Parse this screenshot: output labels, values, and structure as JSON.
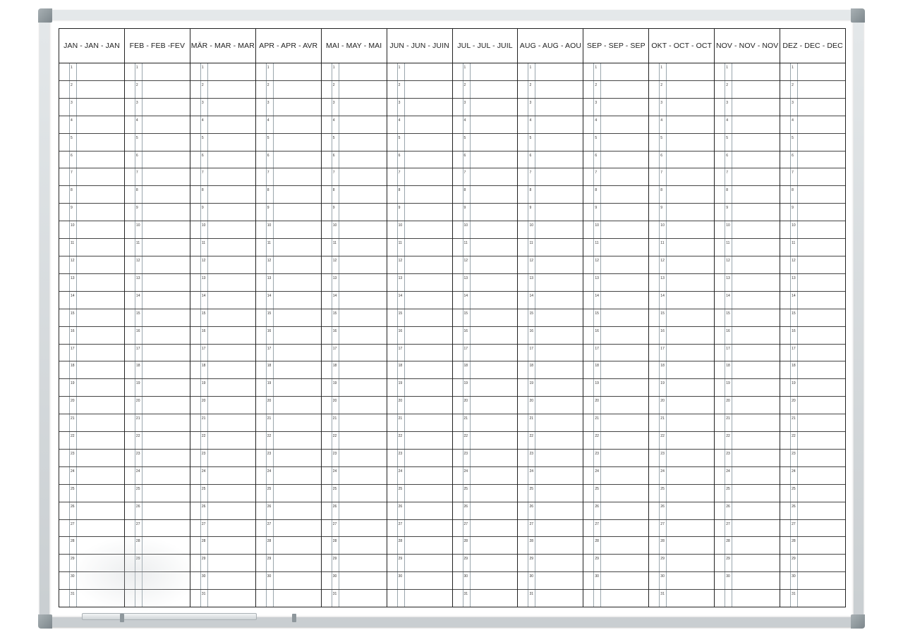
{
  "months": [
    {
      "label": "JAN - JAN - JAN",
      "days": 31
    },
    {
      "label": "FEB - FEB -FEV",
      "days": 29
    },
    {
      "label": "MÄR - MAR - MAR",
      "days": 31
    },
    {
      "label": "APR - APR - AVR",
      "days": 30
    },
    {
      "label": "MAI - MAY - MAI",
      "days": 31
    },
    {
      "label": "JUN - JUN - JUIN",
      "days": 30
    },
    {
      "label": "JUL - JUL - JUIL",
      "days": 31
    },
    {
      "label": "AUG - AUG - AOU",
      "days": 31
    },
    {
      "label": "SEP - SEP - SEP",
      "days": 30
    },
    {
      "label": "OKT - OCT - OCT",
      "days": 31
    },
    {
      "label": "NOV - NOV - NOV",
      "days": 30
    },
    {
      "label": "DEZ - DEC - DEC",
      "days": 31
    }
  ],
  "rows": 31,
  "colors": {
    "frame": "#c9ced1",
    "grid": "#222222",
    "guide": "#9aa6ad"
  }
}
